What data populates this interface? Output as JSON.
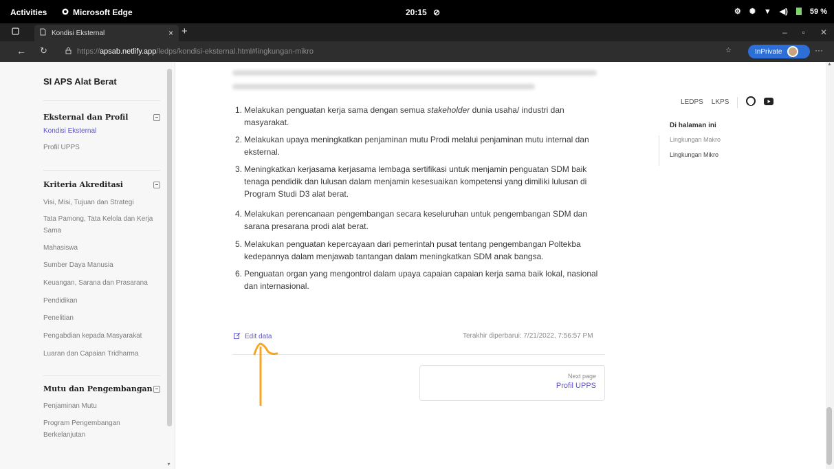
{
  "system": {
    "activities": "Activities",
    "app_name": "Microsoft Edge",
    "clock": "20:15",
    "battery": "59 %"
  },
  "browser": {
    "tab_title": "Kondisi Eksternal",
    "url_scheme": "https://",
    "url_host": "apsab.netlify.app",
    "url_path": "/ledps/kondisi-eksternal.html#lingkungan-mikro",
    "inprivate_label": "InPrivate"
  },
  "sidebar": {
    "brand": "SI APS Alat Berat",
    "groups": [
      {
        "title": "Eksternal dan Profil",
        "items": [
          "Kondisi Eksternal",
          "Profil UPPS"
        ]
      },
      {
        "title": "Kriteria Akreditasi",
        "items": [
          "Visi, Misi, Tujuan dan Strategi",
          "Tata Pamong, Tata Kelola dan Kerja Sama",
          "Mahasiswa",
          "Sumber Daya Manusia",
          "Keuangan, Sarana dan Prasarana",
          "Pendidikan",
          "Penelitian",
          "Pengabdian kepada Masyarakat",
          "Luaran dan Capaian Tridharma"
        ]
      },
      {
        "title": "Mutu dan Pengembangan",
        "items": [
          "Penjaminan Mutu",
          "Program Pengembangan Berkelanjutan"
        ]
      }
    ]
  },
  "content": {
    "items": [
      {
        "num": "1.",
        "text_a": "Melakukan penguatan kerja sama dengan semua ",
        "text_em": "stakeholder",
        "text_b": " dunia usaha/ industri dan masyarakat."
      },
      {
        "num": "2.",
        "text_a": "Melakukan upaya meningkatkan penjaminan mutu Prodi melalui penjaminan mutu internal dan eksternal.",
        "text_em": "",
        "text_b": ""
      },
      {
        "num": "3.",
        "text_a": "Meningkatkan kerjasama kerjasama lembaga sertifikasi untuk menjamin penguatan SDM baik tenaga pendidik dan lulusan dalam menjamin kesesuaikan kompetensi yang dimiliki lulusan di Program Studi D3 alat berat.",
        "text_em": "",
        "text_b": ""
      },
      {
        "num": "4.",
        "text_a": "Melakukan perencanaan pengembangan secara keseluruhan untuk pengembangan SDM dan sarana presarana prodi alat berat.",
        "text_em": "",
        "text_b": ""
      },
      {
        "num": "5.",
        "text_a": "Melakukan penguatan kepercayaan dari pemerintah pusat tentang pengembangan Poltekba kedepannya dalam menjawab tantangan dalam meningkatkan SDM anak bangsa.",
        "text_em": "",
        "text_b": ""
      },
      {
        "num": "6.",
        "text_a": "Penguatan organ yang mengontrol dalam upaya capaian capaian kerja sama baik lokal, nasional dan internasional.",
        "text_em": "",
        "text_b": ""
      }
    ],
    "edit_label": "Edit data",
    "last_updated": "Terakhir diperbarui: 7/21/2022, 7:56:57 PM",
    "next_label": "Next page",
    "next_title": "Profil UPPS"
  },
  "header_links": [
    "LEDPS",
    "LKPS"
  ],
  "toc": {
    "title": "Di halaman ini",
    "items": [
      "Lingkungan Makro",
      "Lingkungan Mikro"
    ]
  },
  "colors": {
    "accent": "#5b54c6",
    "annotation": "#f5a623",
    "inprivate": "#2d6fd6"
  }
}
